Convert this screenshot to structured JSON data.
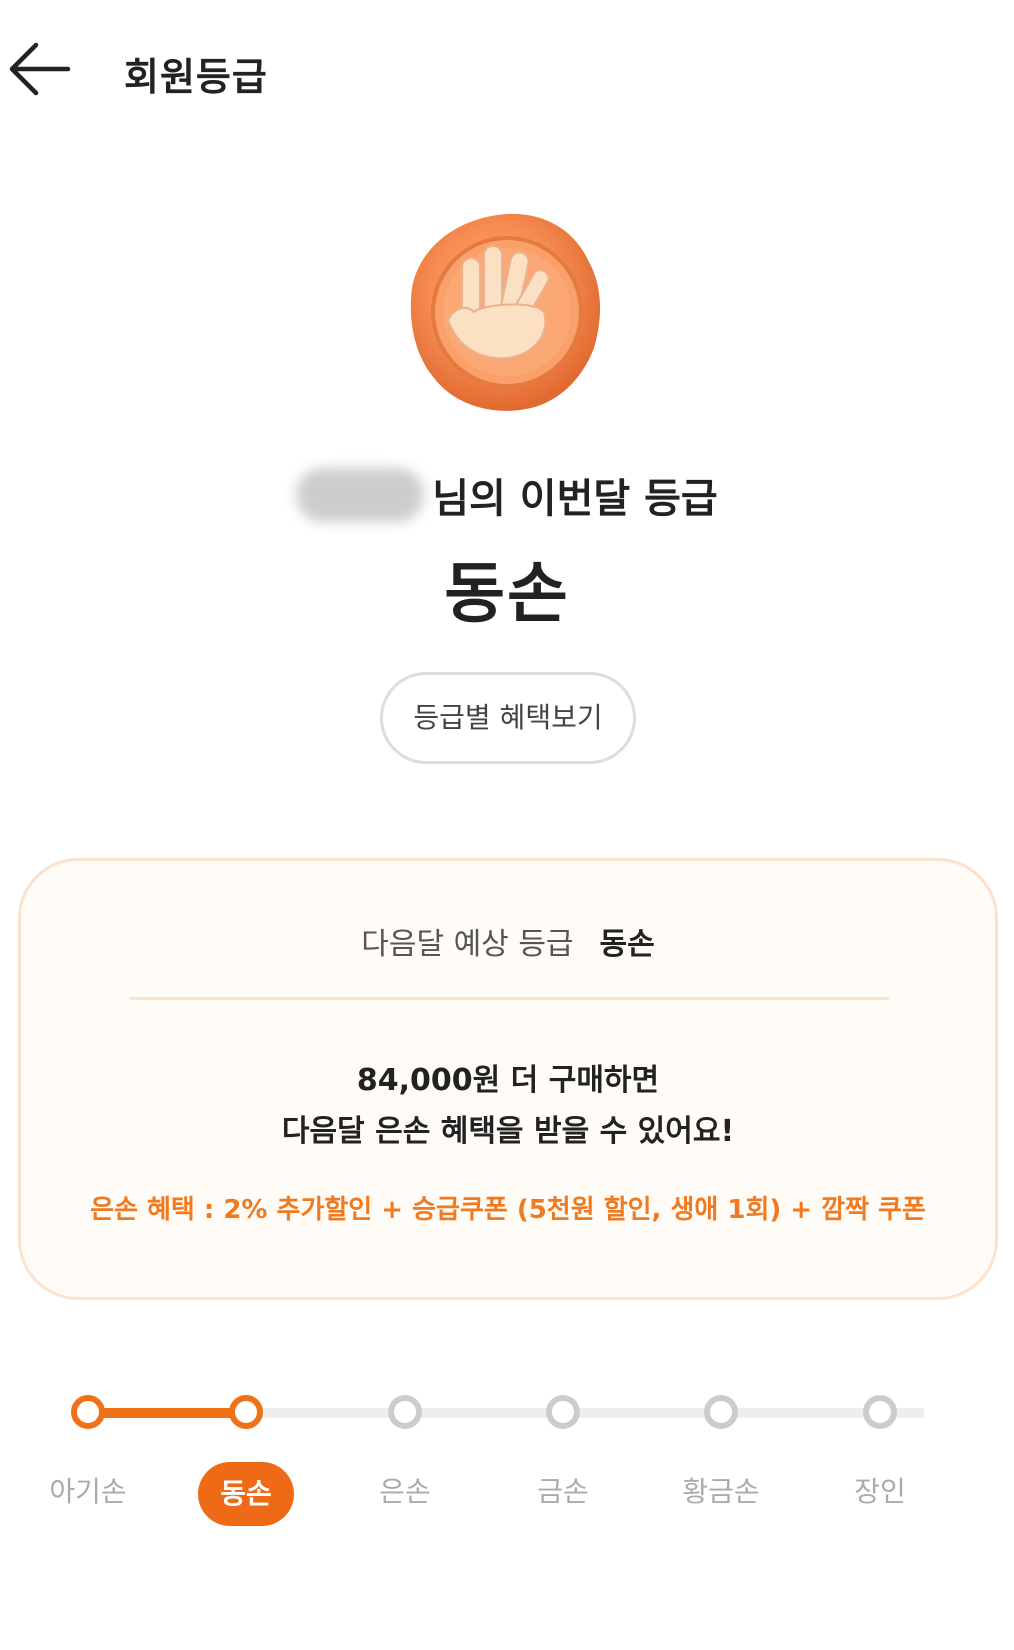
{
  "header": {
    "back_icon": "arrow-left-icon",
    "title": "회원등급"
  },
  "badge": {
    "icon": "wax-seal-hand-icon",
    "colors": {
      "seal": "#f58a4e",
      "hand": "#fbe0c4"
    }
  },
  "current_grade": {
    "caption": "님의 이번달 등급",
    "grade": "동손"
  },
  "benefit_button": {
    "label": "등급별 혜택보기"
  },
  "forecast": {
    "label": "다음달 예상 등급",
    "grade": "동손",
    "message_line1": "84,000원 더 구매하면",
    "message_line2": "다음달 은손 혜택을 받을 수 있어요!",
    "benefit_note": "은손 혜택 : 2% 추가할인 + 승급쿠폰 (5천원 할인, 생애 1회) + 깜짝 쿠폰"
  },
  "tiers": {
    "current_index": 1,
    "items": [
      {
        "label": "아기손"
      },
      {
        "label": "동손"
      },
      {
        "label": "은손"
      },
      {
        "label": "금손"
      },
      {
        "label": "황금손"
      },
      {
        "label": "장인"
      }
    ]
  },
  "colors": {
    "accent": "#ee7118",
    "card_bg": "#fffbf6",
    "card_border": "#fbe3cf",
    "inactive": "#cccccc"
  }
}
